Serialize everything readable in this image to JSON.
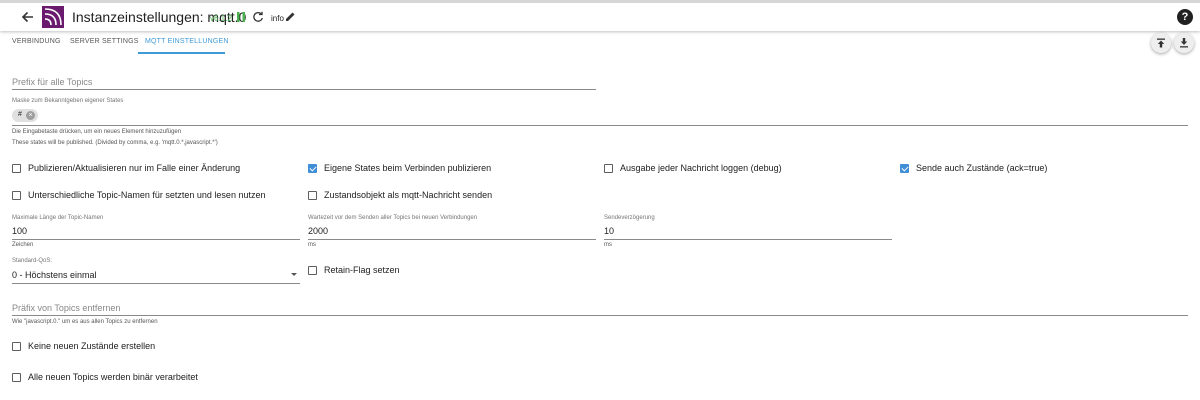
{
  "header": {
    "title": "Instanzeinstellungen: mqtt.0",
    "version": "v6.1.2",
    "info_label": "info",
    "help_label": "?",
    "colors": {
      "version": "#4caf50",
      "accent": "#3f9ad8",
      "checkbox": "#3f8ed6"
    }
  },
  "tabs": [
    {
      "label": "VERBINDUNG",
      "active": false
    },
    {
      "label": "SERVER SETTINGS",
      "active": false
    },
    {
      "label": "MQTT EINSTELLUNGEN",
      "active": true
    }
  ],
  "toolbar": {
    "upload_icon": "upload-icon",
    "download_icon": "download-icon"
  },
  "fields": {
    "prefix": {
      "placeholder": "Prefix für alle Topics",
      "value": ""
    },
    "mask": {
      "label": "Maske zum Bekanntgeben eigener States",
      "chip": "#",
      "helper1": "Die Eingabetaste drücken, um ein neues Element hinzuzufügen",
      "helper2": "These states will be published. (Divided by comma, e.g. 'mqtt.0.*,javascript.*')"
    },
    "max_topic_length": {
      "label": "Maximale Länge der Topic-Namen",
      "value": "100",
      "unit": "Zeichen"
    },
    "send_delay_connect": {
      "label": "Wartezeit vor dem Senden aller Topics bei neuen Verbindungen",
      "value": "2000",
      "unit": "ms"
    },
    "send_interval": {
      "label": "Sendeverzögerung",
      "value": "10",
      "unit": "ms"
    },
    "default_qos": {
      "label": "Standard-QoS:",
      "value": "0 - Höchstens einmal"
    },
    "remove_prefix": {
      "placeholder": "Präfix von Topics entfernen",
      "helper": "Wie \"javascript.0.\" um es aus allen Topics zu entfernen"
    }
  },
  "checkboxes": {
    "on_change": {
      "label": "Publizieren/Aktualisieren nur im Falle einer Änderung",
      "checked": false
    },
    "publish_own_states": {
      "label": "Eigene States beim Verbinden publizieren",
      "checked": true
    },
    "log_each_message": {
      "label": "Ausgabe jeder Nachricht loggen (debug)",
      "checked": false
    },
    "send_ack": {
      "label": "Sende auch Zustände (ack=true)",
      "checked": true
    },
    "different_topic_names": {
      "label": "Unterschiedliche Topic-Namen für setzten und lesen nutzen",
      "checked": false
    },
    "send_state_object": {
      "label": "Zustandsobjekt als mqtt-Nachricht senden",
      "checked": false
    },
    "retain_flag": {
      "label": "Retain-Flag setzen",
      "checked": false
    },
    "no_new_states": {
      "label": "Keine neuen Zustände erstellen",
      "checked": false
    },
    "all_binary": {
      "label": "Alle neuen Topics werden binär verarbeitet",
      "checked": false
    }
  }
}
